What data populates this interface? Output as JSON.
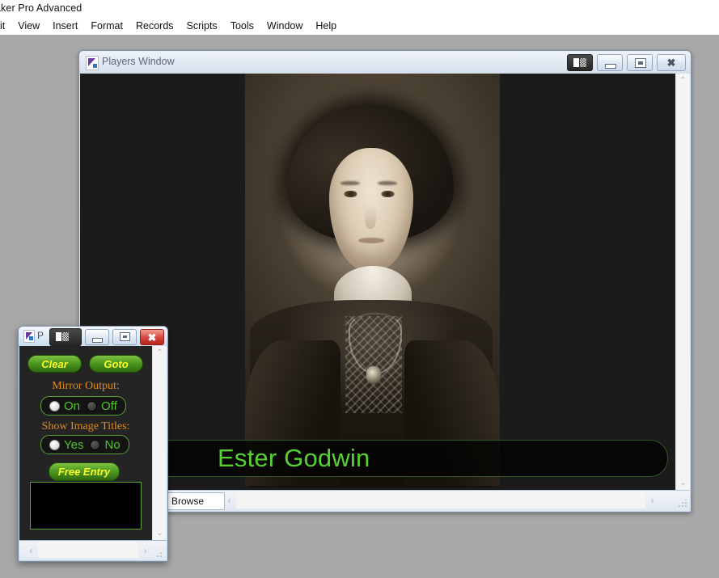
{
  "app": {
    "title": "aker Pro Advanced",
    "menu": [
      {
        "label": "it"
      },
      {
        "label": "View"
      },
      {
        "label": "Insert"
      },
      {
        "label": "Format"
      },
      {
        "label": "Records"
      },
      {
        "label": "Scripts"
      },
      {
        "label": "Tools"
      },
      {
        "label": "Window"
      },
      {
        "label": "Help"
      }
    ]
  },
  "players_window": {
    "title": "Players Window",
    "icon": "filemaker-document-icon",
    "buttons": {
      "restore_dual": "",
      "minimize": "",
      "maximize": "",
      "close": "✖"
    },
    "caption": "Ester Godwin",
    "image_alt": "sepia portrait photograph of a woman",
    "status": {
      "mode": "Browse",
      "scroll_left": "‹",
      "scroll_right": "›"
    },
    "scrollbar": {
      "up": "⌃",
      "down": "⌄"
    }
  },
  "control_window": {
    "title": "P",
    "icon": "filemaker-document-icon",
    "buttons": {
      "restore_dual": "",
      "minimize": "",
      "maximize": "",
      "close": "✖"
    },
    "actions": {
      "clear": "Clear",
      "goto": "Goto",
      "free_entry": "Free Entry"
    },
    "mirror_output": {
      "label": "Mirror Output:",
      "options": [
        {
          "label": "On",
          "selected": true
        },
        {
          "label": "Off",
          "selected": false
        }
      ]
    },
    "show_image_titles": {
      "label": "Show Image Titles:",
      "options": [
        {
          "label": "Yes",
          "selected": true
        },
        {
          "label": "No",
          "selected": false
        }
      ]
    },
    "entry_field_value": "",
    "scrollbar": {
      "up": "⌃",
      "down": "⌄",
      "left": "‹",
      "right": "›"
    }
  },
  "colors": {
    "accent_green": "#57d131",
    "button_yellow": "#fbfb28",
    "label_orange": "#e08a1e",
    "panel_black": "#242424",
    "desktop_gray": "#a8a8a8"
  }
}
